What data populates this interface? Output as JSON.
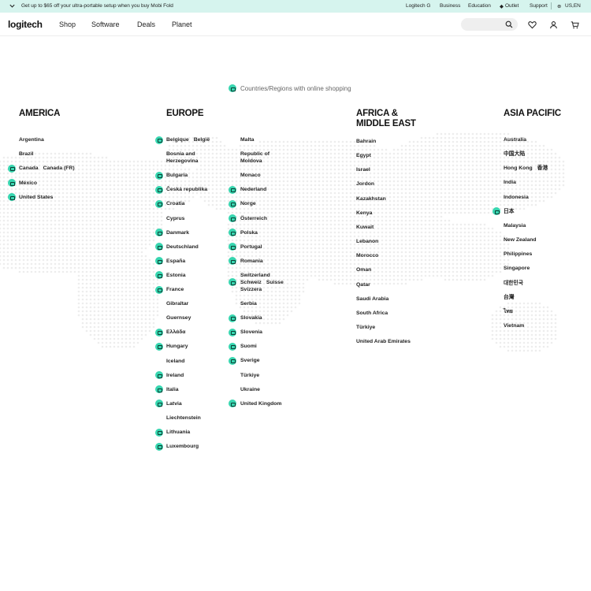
{
  "promo": {
    "text": "Get up to $65 off your ultra-portable setup when you buy Mobi Fold",
    "links": [
      "Logitech G",
      "Business",
      "Education",
      "Outlet",
      "Support",
      "US,EN"
    ]
  },
  "header": {
    "logo": "logitech",
    "nav": [
      "Shop",
      "Software",
      "Deals",
      "Planet"
    ]
  },
  "legend": "Countries/Regions with online shopping",
  "regions": {
    "america": {
      "title": "AMERICA",
      "countries": [
        {
          "name": "Argentina",
          "shop": false
        },
        {
          "name": "Brazil",
          "shop": false
        },
        {
          "name": "Canada",
          "name2": "Canada (FR)",
          "shop": true
        },
        {
          "name": "México",
          "shop": true
        },
        {
          "name": "United States",
          "shop": true
        }
      ]
    },
    "europe": {
      "title": "EUROPE",
      "col1": [
        {
          "name": "Belgique",
          "name2": "België",
          "shop": true
        },
        {
          "name": "Bosnia and",
          "line2": "Herzegovina",
          "shop": false
        },
        {
          "name": "Bulgaria",
          "shop": true
        },
        {
          "name": "Česká republika",
          "shop": true
        },
        {
          "name": "Croatia",
          "shop": true
        },
        {
          "name": "Cyprus",
          "shop": false
        },
        {
          "name": "Danmark",
          "shop": true
        },
        {
          "name": "Deutschland",
          "shop": true
        },
        {
          "name": "España",
          "shop": true
        },
        {
          "name": "Estonia",
          "shop": true
        },
        {
          "name": "France",
          "shop": true
        },
        {
          "name": "Gibraltar",
          "shop": false
        },
        {
          "name": "Guernsey",
          "shop": false
        },
        {
          "name": "Ελλάδα",
          "shop": true
        },
        {
          "name": "Hungary",
          "shop": true
        },
        {
          "name": "Iceland",
          "shop": false
        },
        {
          "name": "Ireland",
          "shop": true
        },
        {
          "name": "Italia",
          "shop": true
        },
        {
          "name": "Latvia",
          "shop": true
        },
        {
          "name": "Liechtenstein",
          "shop": false
        },
        {
          "name": "Lithuania",
          "shop": true
        },
        {
          "name": "Luxembourg",
          "shop": true
        }
      ],
      "col2": [
        {
          "name": "Malta",
          "shop": false
        },
        {
          "name": "Republic of",
          "line2": "Moldova",
          "shop": false
        },
        {
          "name": "Monaco",
          "shop": false
        },
        {
          "name": "Nederland",
          "shop": true
        },
        {
          "name": "Norge",
          "shop": true
        },
        {
          "name": "Österreich",
          "shop": true
        },
        {
          "name": "Polska",
          "shop": true
        },
        {
          "name": "Portugal",
          "shop": true
        },
        {
          "name": "Romania",
          "shop": true
        },
        {
          "name": "Switzerland",
          "line2": "Schweiz",
          "line2b": "Suisse",
          "line3": "Svizzera",
          "shop": true
        },
        {
          "name": "Serbia",
          "shop": false
        },
        {
          "name": "Slovakia",
          "shop": true
        },
        {
          "name": "Slovenia",
          "shop": true
        },
        {
          "name": "Suomi",
          "shop": true
        },
        {
          "name": "Sverige",
          "shop": true
        },
        {
          "name": "Türkiye",
          "shop": false
        },
        {
          "name": "Ukraine",
          "shop": false
        },
        {
          "name": "United Kingdom",
          "shop": true
        }
      ]
    },
    "africa": {
      "title": "AFRICA &",
      "title2": "MIDDLE EAST",
      "countries": [
        {
          "name": "Bahrain",
          "shop": false
        },
        {
          "name": "Egypt",
          "shop": false
        },
        {
          "name": "Israel",
          "shop": false
        },
        {
          "name": "Jordon",
          "shop": false
        },
        {
          "name": "Kazakhstan",
          "shop": false
        },
        {
          "name": "Kenya",
          "shop": false
        },
        {
          "name": "Kuwait",
          "shop": false
        },
        {
          "name": "Lebanon",
          "shop": false
        },
        {
          "name": "Morocco",
          "shop": false
        },
        {
          "name": "Oman",
          "shop": false
        },
        {
          "name": "Qatar",
          "shop": false
        },
        {
          "name": "Saudi Arabia",
          "shop": false
        },
        {
          "name": "South Africa",
          "shop": false
        },
        {
          "name": "Türkiye",
          "shop": false
        },
        {
          "name": "United Arab Emirates",
          "shop": false
        }
      ]
    },
    "asia": {
      "title": "ASIA PACIFIC",
      "countries": [
        {
          "name": "Australia",
          "shop": false
        },
        {
          "name": "中国大陆",
          "shop": false
        },
        {
          "name": "Hong Kong",
          "name2": "香港",
          "shop": false
        },
        {
          "name": "India",
          "shop": false
        },
        {
          "name": "Indonesia",
          "shop": false
        },
        {
          "name": "日本",
          "shop": true
        },
        {
          "name": "Malaysia",
          "shop": false
        },
        {
          "name": "New Zealand",
          "shop": false
        },
        {
          "name": "Philippines",
          "shop": false
        },
        {
          "name": "Singapore",
          "shop": false
        },
        {
          "name": "대한민국",
          "shop": false
        },
        {
          "name": "台灣",
          "shop": false
        },
        {
          "name": "ไทย",
          "shop": false
        },
        {
          "name": "Vietnam",
          "shop": false
        }
      ]
    }
  },
  "colors": {
    "accent": "#38d6b0",
    "promo_bg": "#d6f4ee"
  }
}
